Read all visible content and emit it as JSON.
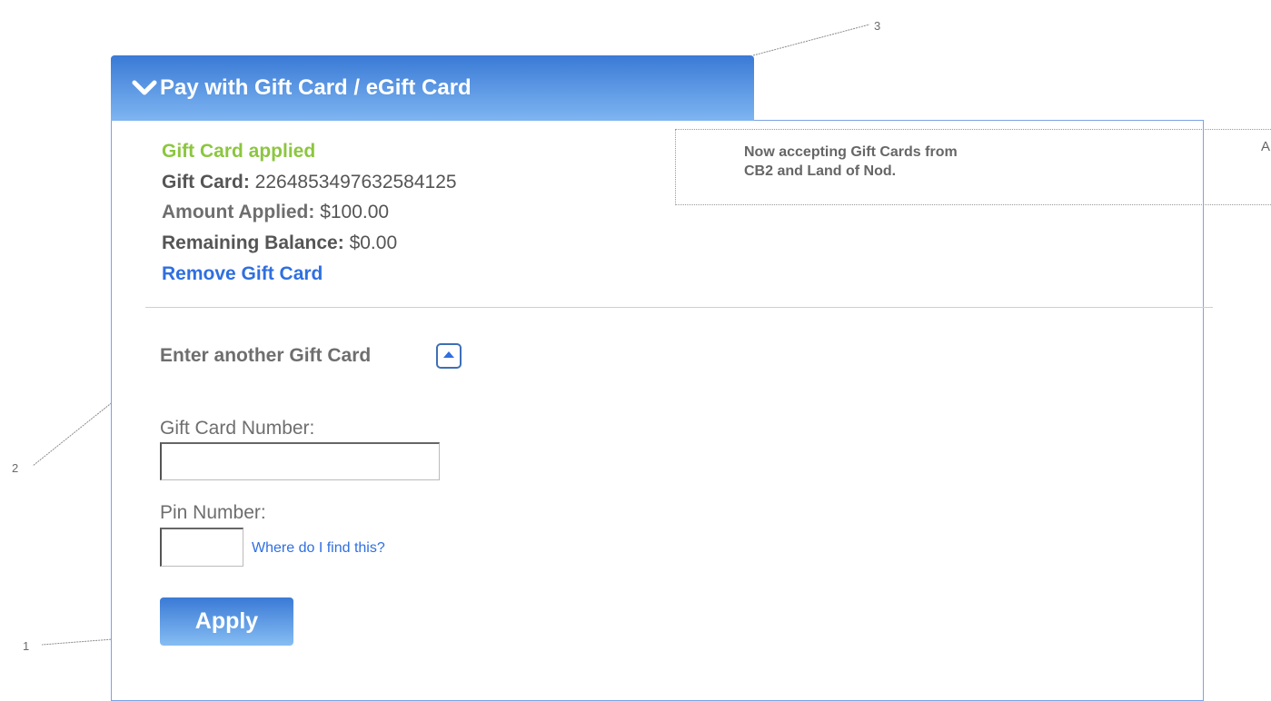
{
  "header": {
    "title": "Pay with Gift Card / eGift Card"
  },
  "applied": {
    "status": "Gift Card applied",
    "card_label": "Gift Card:",
    "card_number": "2264853497632584125",
    "amount_label": "Amount Applied:",
    "amount_value": "$100.00",
    "remaining_label": "Remaining Balance:",
    "remaining_value": "$0.00",
    "remove_link": "Remove Gift Card"
  },
  "promo": {
    "line1": "Now accepting Gift Cards from",
    "line2": "CB2 and Land of Nod.",
    "marker": "A"
  },
  "form": {
    "section_title": "Enter another Gift Card",
    "card_number_label": "Gift Card Number:",
    "card_number_value": "",
    "pin_label": "Pin Number:",
    "pin_value": "",
    "find_link": "Where do I find this?",
    "apply_button": "Apply"
  },
  "annotations": [
    "1",
    "2",
    "3"
  ],
  "colors": {
    "header_gradient_top": "#3a7ad6",
    "header_gradient_bottom": "#7eb5f1",
    "status_green": "#8cc63f",
    "link_blue": "#2f6fe0",
    "panel_border": "#7aa3e5"
  }
}
